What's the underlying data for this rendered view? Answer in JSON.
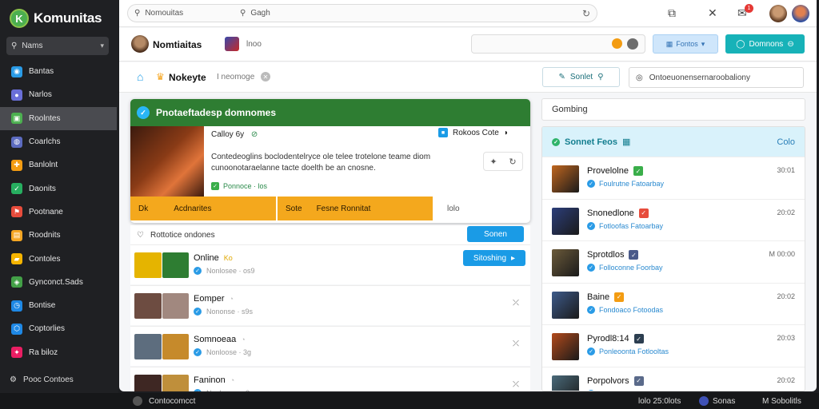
{
  "sidebar": {
    "brand": "Komunitas",
    "search_label": "Nams",
    "items": [
      {
        "label": "Bantas",
        "icon": "globe-icon",
        "color": "#2a9be6"
      },
      {
        "label": "Narlos",
        "icon": "users-icon",
        "color": "#6a6fd8"
      },
      {
        "label": "Roolntes",
        "icon": "image-icon",
        "color": "#4caf50"
      },
      {
        "label": "Coarlchs",
        "icon": "chat-icon",
        "color": "#5c6bc0"
      },
      {
        "label": "Banlolnt",
        "icon": "puzzle-icon",
        "color": "#f39c12"
      },
      {
        "label": "Daonits",
        "icon": "check-icon",
        "color": "#27ae60"
      },
      {
        "label": "Pootnane",
        "icon": "flag-icon",
        "color": "#e74c3c"
      },
      {
        "label": "Roodnits",
        "icon": "calendar-icon",
        "color": "#f5a623"
      },
      {
        "label": "Contoles",
        "icon": "folder-icon",
        "color": "#f5b400"
      },
      {
        "label": "Gynconct.Sads",
        "icon": "map-icon",
        "color": "#43a047"
      },
      {
        "label": "Bontise",
        "icon": "clock-icon",
        "color": "#1e88e5"
      },
      {
        "label": "Coptorlies",
        "icon": "shield-icon",
        "color": "#1e88e5"
      },
      {
        "label": "Ra biloz",
        "icon": "bookmark-icon",
        "color": "#e91e63"
      }
    ],
    "active_index": 2,
    "footer": "Pooc Contoes"
  },
  "topbar": {
    "url_text": "Nomouitas",
    "search_text": "Gagh"
  },
  "subbar": {
    "title": "Nomtiaitas",
    "tag": "lnoo",
    "light_button": "Fontos",
    "teal_button": "Domnons"
  },
  "toolbar": {
    "title": "Nokeyte",
    "subtitle": "I neomoge",
    "button": "Sonlet",
    "input": "Ontoeuonensernaroobaliony"
  },
  "feature": {
    "header": "Pnotaeftadesp domnomes",
    "subtitle": "Calloy 6y",
    "right_label": "Rokoos Cote",
    "description": "Contedeoglins boclodentelryce ole telee trotelone teame diom cunoonotaraelanne tacte doelth be an cnosne.",
    "meta": "Ponnoce · los",
    "foot_a_1": "Dk",
    "foot_a_2": "Acdnarites",
    "foot_b_1": "Sote",
    "foot_b_2": "Fesne Ronnitat",
    "foot_c": "lolo"
  },
  "left_list": {
    "header": "Rottotice ondones",
    "header_button": "Sonen",
    "rows": [
      {
        "name": "Online",
        "tag": "Ko",
        "meta": "Nonlosee · os9",
        "action": "Sitoshing",
        "thumbs": [
          "#e5b400",
          "#2e7d32"
        ]
      },
      {
        "name": "Eomper",
        "tag": "",
        "meta": "Nononse · s9s",
        "action": "⤫",
        "thumbs": [
          "#6d4c41",
          "#a1887f"
        ]
      },
      {
        "name": "Somnoeaa",
        "tag": "",
        "meta": "Nonloose · 3g",
        "action": "⤫",
        "thumbs": [
          "#5d6d7e",
          "#c68a2b"
        ]
      },
      {
        "name": "Faninon",
        "tag": "",
        "meta": "Nonlosore · 3p",
        "action": "⤫",
        "thumbs": [
          "#3e2723",
          "#bf8f3b"
        ]
      }
    ]
  },
  "right_panel": {
    "header": "Gombing",
    "title": "Sonnet Feos",
    "title_right": "Colo",
    "rows": [
      {
        "name": "Provelolne",
        "sub": "Foulrutne Fatoarbay",
        "time": "30:01",
        "thumb": "#c0661f",
        "mini": "#3aae4a"
      },
      {
        "name": "Snonedlone",
        "sub": "Fotloofas Fatoarbay",
        "time": "20:02",
        "thumb": "#2c3e7a",
        "mini": "#e74c3c"
      },
      {
        "name": "Sprotdlos",
        "sub": "Folloconne Foorbay",
        "time": "M 00:00",
        "thumb": "#6b5a3a",
        "mini": "#4a5a8a"
      },
      {
        "name": "Baine",
        "sub": "Fondoaco Fotoodas",
        "time": "20:02",
        "thumb": "#3d5a8a",
        "mini": "#f39c12"
      },
      {
        "name": "Pyrodl8:14",
        "sub": "Ponleoonta Fotlooltas",
        "time": "20:03",
        "thumb": "#b34a1b",
        "mini": "#2c3e50"
      },
      {
        "name": "Porpolvors",
        "sub": "Ponlotos Fatoarbay",
        "time": "20:02",
        "thumb": "#4a6a7a",
        "mini": "#5a6a8a"
      }
    ]
  },
  "statusbar": {
    "left": "Contocomcct",
    "mid": "lolo 25:0lots",
    "right_1": "Sonas",
    "right_2": "M Sobolitls"
  }
}
